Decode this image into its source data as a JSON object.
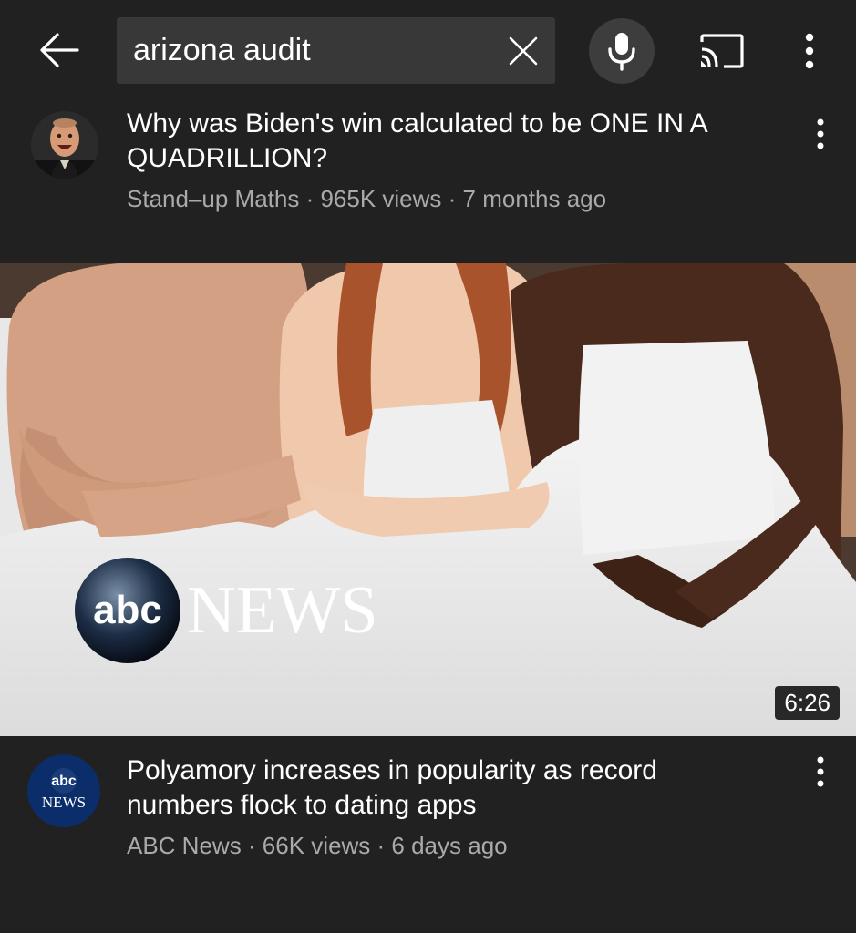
{
  "search": {
    "query": "arizona audit"
  },
  "videos": [
    {
      "title": "Why was Biden's win calculated to be ONE IN A QUADRILLION?",
      "channel": "Stand–up Maths",
      "views": "965K views",
      "age": "7 months ago",
      "meta": "Stand–up Maths · 965K views · 7 months ago"
    },
    {
      "title": "Polyamory increases in popularity as record numbers flock to dating apps",
      "channel": "ABC News",
      "views": "66K views",
      "age": "6 days ago",
      "meta": "ABC News · 66K views · 6 days ago",
      "duration": "6:26",
      "thumbnail_logo_text": "NEWS",
      "thumbnail_logo_badge": "abc",
      "avatar_badge": "abc",
      "avatar_text": "NEWS"
    }
  ],
  "colors": {
    "background": "#212121",
    "search_field": "#383838",
    "meta_text": "#aaaaaa",
    "abc_blue": "#0b2e6b"
  },
  "icons": {
    "back": "arrow-left-icon",
    "clear": "close-icon",
    "mic": "mic-icon",
    "cast": "cast-icon",
    "more": "more-vert-icon"
  }
}
